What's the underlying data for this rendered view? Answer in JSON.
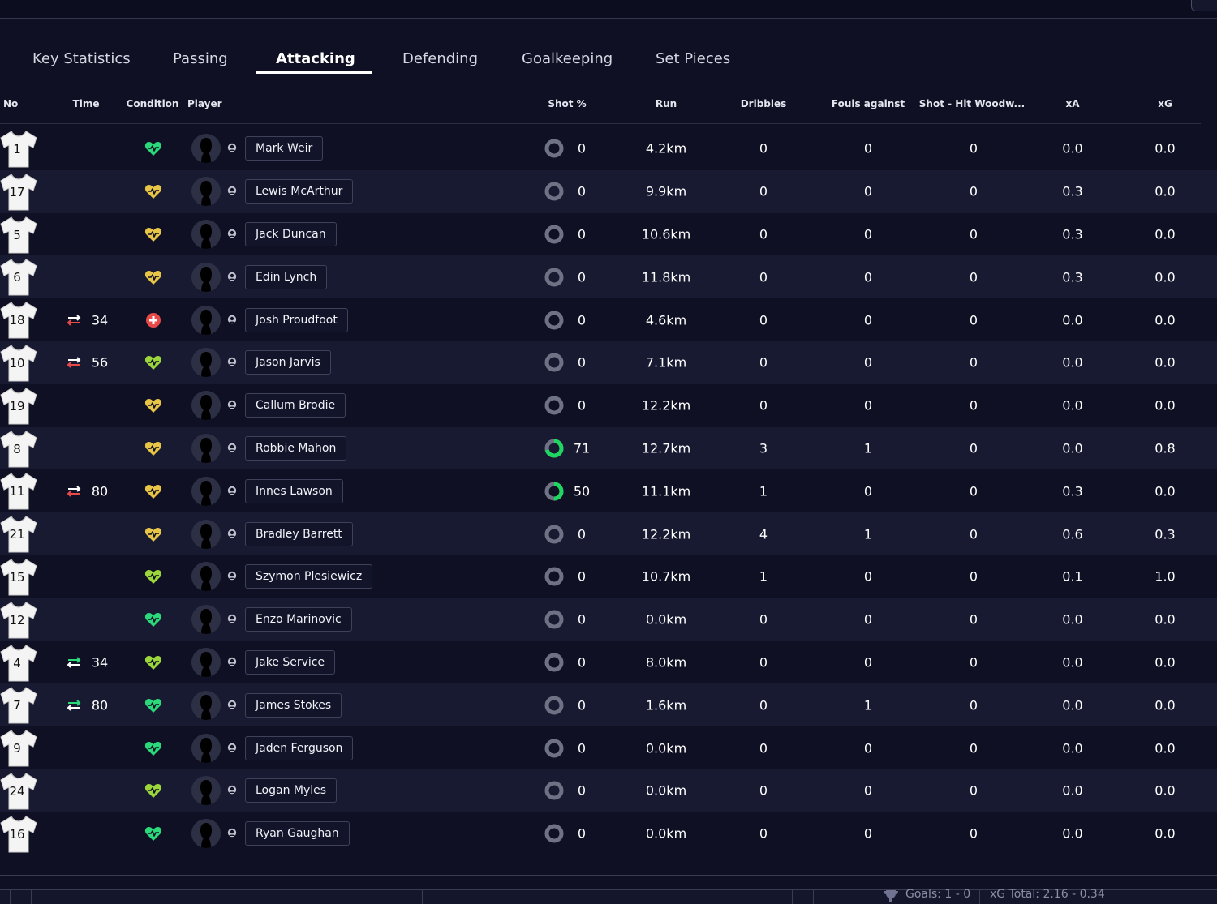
{
  "tabs": [
    {
      "label": "Key Statistics",
      "active": false
    },
    {
      "label": "Passing",
      "active": false
    },
    {
      "label": "Attacking",
      "active": true
    },
    {
      "label": "Defending",
      "active": false
    },
    {
      "label": "Goalkeeping",
      "active": false
    },
    {
      "label": "Set Pieces",
      "active": false
    }
  ],
  "columns": {
    "no": "No",
    "time": "Time",
    "condition": "Condition",
    "player": "Player",
    "shot_pct": "Shot %",
    "run": "Run",
    "dribbles": "Dribbles",
    "fouls_against": "Fouls against",
    "shot_woodwork": "Shot - Hit Woodw...",
    "xa": "xA",
    "xg": "xG"
  },
  "colors": {
    "accent_green": "#1ed760",
    "condition_green": "#2bd87a",
    "condition_lime": "#9bd63b",
    "condition_yellow": "#e8c547",
    "injury_red": "#e84a4a",
    "sub_out": "#e84a4a",
    "sub_in": "#2bd87a"
  },
  "players": [
    {
      "no": "1",
      "time": "",
      "sub": "",
      "condition": "green",
      "name": "Mark Weir",
      "shot_pct": "0",
      "run": "4.2km",
      "dribbles": "0",
      "fouls": "0",
      "woodwork": "0",
      "xa": "0.0",
      "xg": "0.0"
    },
    {
      "no": "17",
      "time": "",
      "sub": "",
      "condition": "yellow",
      "name": "Lewis McArthur",
      "shot_pct": "0",
      "run": "9.9km",
      "dribbles": "0",
      "fouls": "0",
      "woodwork": "0",
      "xa": "0.3",
      "xg": "0.0"
    },
    {
      "no": "5",
      "time": "",
      "sub": "",
      "condition": "yellow",
      "name": "Jack Duncan",
      "shot_pct": "0",
      "run": "10.6km",
      "dribbles": "0",
      "fouls": "0",
      "woodwork": "0",
      "xa": "0.3",
      "xg": "0.0"
    },
    {
      "no": "6",
      "time": "",
      "sub": "",
      "condition": "yellow",
      "name": "Edin Lynch",
      "shot_pct": "0",
      "run": "11.8km",
      "dribbles": "0",
      "fouls": "0",
      "woodwork": "0",
      "xa": "0.3",
      "xg": "0.0"
    },
    {
      "no": "18",
      "time": "34",
      "sub": "off",
      "condition": "injury",
      "name": "Josh Proudfoot",
      "shot_pct": "0",
      "run": "4.6km",
      "dribbles": "0",
      "fouls": "0",
      "woodwork": "0",
      "xa": "0.0",
      "xg": "0.0"
    },
    {
      "no": "10",
      "time": "56",
      "sub": "off",
      "condition": "lime",
      "name": "Jason Jarvis",
      "shot_pct": "0",
      "run": "7.1km",
      "dribbles": "0",
      "fouls": "0",
      "woodwork": "0",
      "xa": "0.0",
      "xg": "0.0"
    },
    {
      "no": "19",
      "time": "",
      "sub": "",
      "condition": "yellow",
      "name": "Callum Brodie",
      "shot_pct": "0",
      "run": "12.2km",
      "dribbles": "0",
      "fouls": "0",
      "woodwork": "0",
      "xa": "0.0",
      "xg": "0.0"
    },
    {
      "no": "8",
      "time": "",
      "sub": "",
      "condition": "yellow",
      "name": "Robbie Mahon",
      "shot_pct": "71",
      "run": "12.7km",
      "dribbles": "3",
      "fouls": "1",
      "woodwork": "0",
      "xa": "0.0",
      "xg": "0.8"
    },
    {
      "no": "11",
      "time": "80",
      "sub": "off",
      "condition": "yellow",
      "name": "Innes Lawson",
      "shot_pct": "50",
      "run": "11.1km",
      "dribbles": "1",
      "fouls": "0",
      "woodwork": "0",
      "xa": "0.3",
      "xg": "0.0"
    },
    {
      "no": "21",
      "time": "",
      "sub": "",
      "condition": "yellow",
      "name": "Bradley Barrett",
      "shot_pct": "0",
      "run": "12.2km",
      "dribbles": "4",
      "fouls": "1",
      "woodwork": "0",
      "xa": "0.6",
      "xg": "0.3"
    },
    {
      "no": "15",
      "time": "",
      "sub": "",
      "condition": "lime",
      "name": "Szymon Plesiewicz",
      "shot_pct": "0",
      "run": "10.7km",
      "dribbles": "1",
      "fouls": "0",
      "woodwork": "0",
      "xa": "0.1",
      "xg": "1.0"
    },
    {
      "no": "12",
      "time": "",
      "sub": "",
      "condition": "green",
      "name": "Enzo Marinovic",
      "shot_pct": "0",
      "run": "0.0km",
      "dribbles": "0",
      "fouls": "0",
      "woodwork": "0",
      "xa": "0.0",
      "xg": "0.0"
    },
    {
      "no": "4",
      "time": "34",
      "sub": "on",
      "condition": "lime",
      "name": "Jake Service",
      "shot_pct": "0",
      "run": "8.0km",
      "dribbles": "0",
      "fouls": "0",
      "woodwork": "0",
      "xa": "0.0",
      "xg": "0.0"
    },
    {
      "no": "7",
      "time": "80",
      "sub": "on",
      "condition": "green",
      "name": "James Stokes",
      "shot_pct": "0",
      "run": "1.6km",
      "dribbles": "0",
      "fouls": "1",
      "woodwork": "0",
      "xa": "0.0",
      "xg": "0.0"
    },
    {
      "no": "9",
      "time": "",
      "sub": "",
      "condition": "green",
      "name": "Jaden Ferguson",
      "shot_pct": "0",
      "run": "0.0km",
      "dribbles": "0",
      "fouls": "0",
      "woodwork": "0",
      "xa": "0.0",
      "xg": "0.0"
    },
    {
      "no": "24",
      "time": "",
      "sub": "",
      "condition": "lime",
      "name": "Logan Myles",
      "shot_pct": "0",
      "run": "0.0km",
      "dribbles": "0",
      "fouls": "0",
      "woodwork": "0",
      "xa": "0.0",
      "xg": "0.0"
    },
    {
      "no": "16",
      "time": "",
      "sub": "",
      "condition": "green",
      "name": "Ryan Gaughan",
      "shot_pct": "0",
      "run": "0.0km",
      "dribbles": "0",
      "fouls": "0",
      "woodwork": "0",
      "xa": "0.0",
      "xg": "0.0"
    }
  ],
  "footer": {
    "goals": "Goals: 1 - 0",
    "xg_total": "xG Total: 2.16 - 0.34"
  }
}
